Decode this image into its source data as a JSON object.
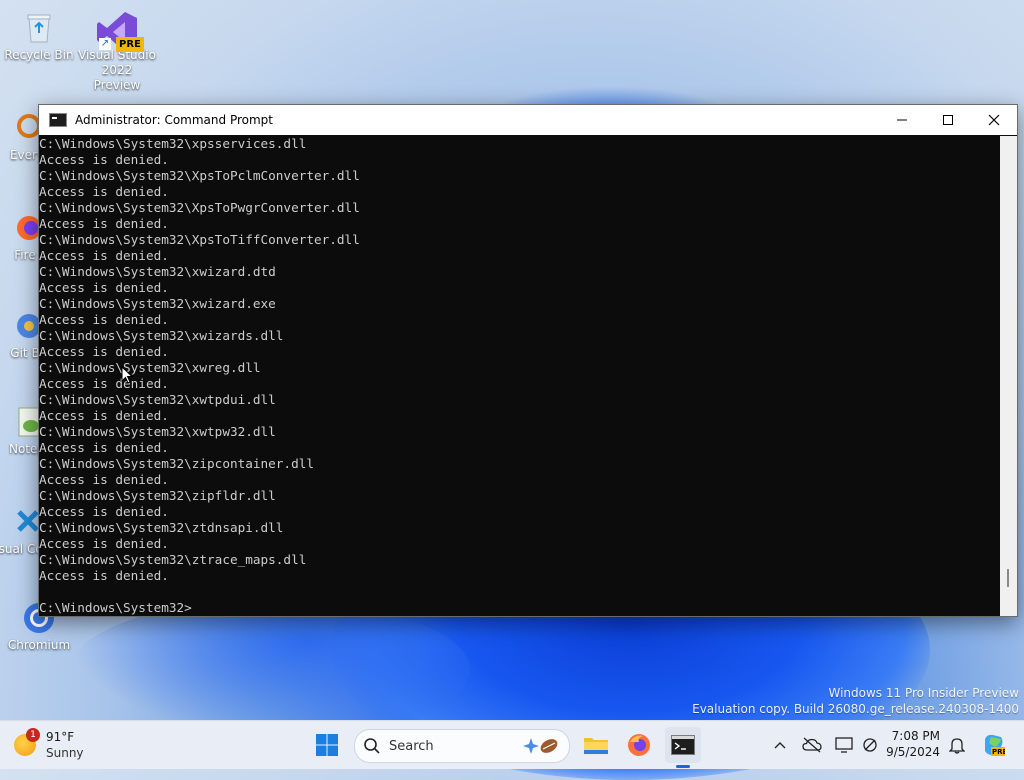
{
  "desktop": {
    "icons": [
      {
        "label": "Recycle Bin"
      },
      {
        "label": "Visual Studio 2022 Preview",
        "badge": "PRE"
      },
      {
        "label": "Every"
      },
      {
        "label": "Fire"
      },
      {
        "label": "Git B"
      },
      {
        "label": "Notep"
      },
      {
        "label": "Visual Co"
      },
      {
        "label": "Chromium"
      }
    ],
    "watermark": {
      "line1": "Windows 11 Pro Insider Preview",
      "line2": "Evaluation copy. Build 26080.ge_release.240308-1400"
    }
  },
  "window": {
    "title": "Administrator: Command Prompt",
    "lines": [
      "C:\\Windows\\System32\\xpsservices.dll",
      "Access is denied.",
      "C:\\Windows\\System32\\XpsToPclmConverter.dll",
      "Access is denied.",
      "C:\\Windows\\System32\\XpsToPwgrConverter.dll",
      "Access is denied.",
      "C:\\Windows\\System32\\XpsToTiffConverter.dll",
      "Access is denied.",
      "C:\\Windows\\System32\\xwizard.dtd",
      "Access is denied.",
      "C:\\Windows\\System32\\xwizard.exe",
      "Access is denied.",
      "C:\\Windows\\System32\\xwizards.dll",
      "Access is denied.",
      "C:\\Windows\\System32\\xwreg.dll",
      "Access is denied.",
      "C:\\Windows\\System32\\xwtpdui.dll",
      "Access is denied.",
      "C:\\Windows\\System32\\xwtpw32.dll",
      "Access is denied.",
      "C:\\Windows\\System32\\zipcontainer.dll",
      "Access is denied.",
      "C:\\Windows\\System32\\zipfldr.dll",
      "Access is denied.",
      "C:\\Windows\\System32\\ztdnsapi.dll",
      "Access is denied.",
      "C:\\Windows\\System32\\ztrace_maps.dll",
      "Access is denied.",
      "",
      "C:\\Windows\\System32>"
    ]
  },
  "taskbar": {
    "weather": {
      "temp": "91°F",
      "condition": "Sunny",
      "badge": "1"
    },
    "search": {
      "placeholder": "Search"
    },
    "clock": {
      "time": "7:08 PM",
      "date": "9/5/2024"
    },
    "icons": [
      "start-icon",
      "search-icon",
      "file-explorer-icon",
      "firefox-icon",
      "terminal-icon",
      "chevron-up-icon",
      "cloud-off-icon",
      "display-icon",
      "network-icon",
      "bell-icon",
      "copilot-icon"
    ],
    "colors": {
      "accent": "#1a66d6"
    }
  }
}
